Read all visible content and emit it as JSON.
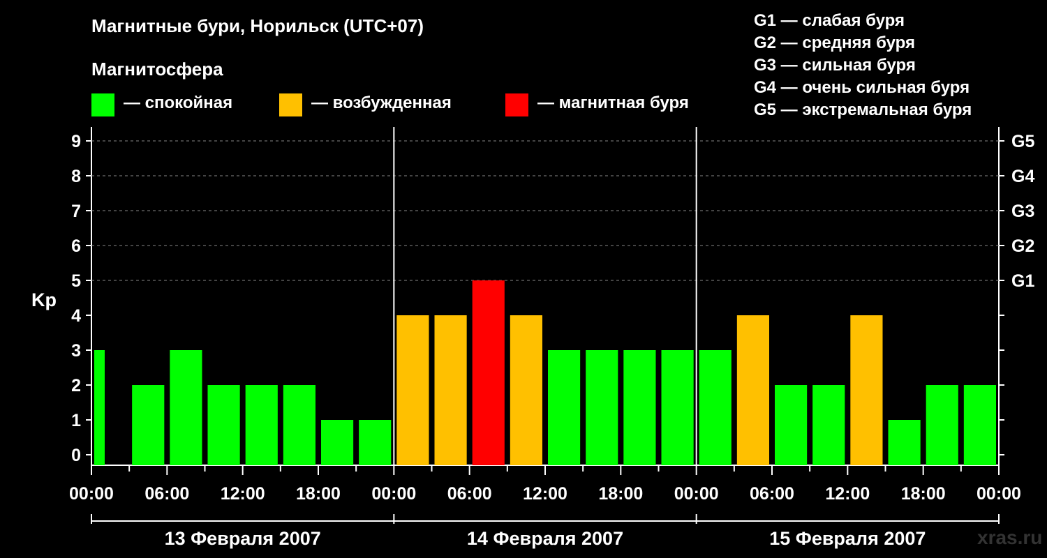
{
  "chart_data": {
    "type": "bar",
    "title": "Магнитные бури, Норильск (UTC+07)",
    "subtitle": "Магнитосфера",
    "ylabel": "Kp",
    "ylim": [
      0,
      9
    ],
    "yticks": [
      "0",
      "1",
      "2",
      "3",
      "4",
      "5",
      "6",
      "7",
      "8",
      "9"
    ],
    "storm_levels": [
      {
        "kp": 5,
        "label": "G1"
      },
      {
        "kp": 6,
        "label": "G2"
      },
      {
        "kp": 7,
        "label": "G3"
      },
      {
        "kp": 8,
        "label": "G4"
      },
      {
        "kp": 9,
        "label": "G5"
      }
    ],
    "legend": [
      {
        "label": "— спокойная",
        "color": "#00ff00"
      },
      {
        "label": "— возбужденная",
        "color": "#ffc000"
      },
      {
        "label": "— магнитная буря",
        "color": "#ff0000"
      }
    ],
    "storm_legend": [
      "G1 — слабая буря",
      "G2 — средняя буря",
      "G3 — сильная буря",
      "G4 — очень сильная буря",
      "G5 — экстремальная буря"
    ],
    "days": [
      "13 Февраля 2007",
      "14 Февраля 2007",
      "15 Февраля 2007"
    ],
    "xtick_labels": [
      "00:00",
      "06:00",
      "12:00",
      "18:00",
      "00:00",
      "06:00",
      "12:00",
      "18:00",
      "00:00",
      "06:00",
      "12:00",
      "18:00",
      "00:00"
    ],
    "bar_hours": [
      "00:00",
      "03:00",
      "06:00",
      "09:00",
      "12:00",
      "15:00",
      "18:00",
      "21:00"
    ],
    "values": [
      [
        3,
        2,
        3,
        2,
        2,
        2,
        1,
        1
      ],
      [
        4,
        4,
        5,
        4,
        3,
        3,
        3,
        3
      ],
      [
        3,
        4,
        2,
        2,
        4,
        1,
        2,
        2
      ]
    ],
    "colors": {
      "quiet": "#00ff00",
      "active": "#ffc000",
      "storm": "#ff0000",
      "grid": "#888888"
    }
  },
  "watermark": "xras.ru"
}
